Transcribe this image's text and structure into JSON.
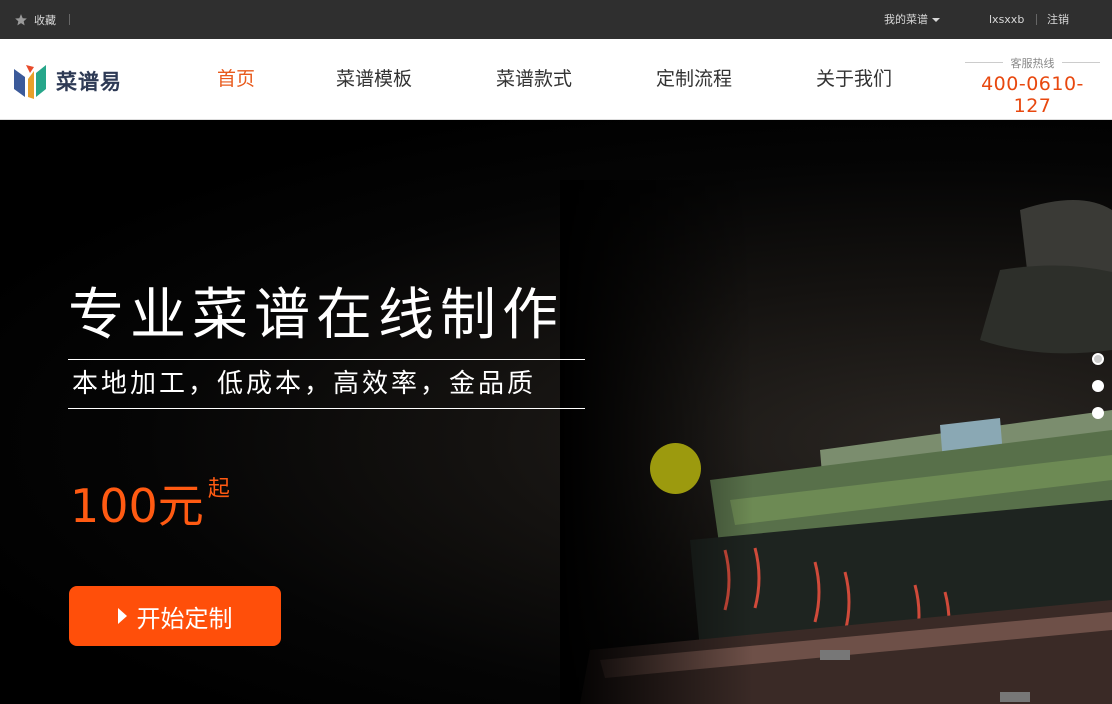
{
  "topbar": {
    "favorite_label": "收藏",
    "my_menu_label": "我的菜谱",
    "username": "lxsxxb",
    "logout_label": "注销"
  },
  "header": {
    "logo_text": "菜谱易",
    "nav": [
      {
        "label": "首页",
        "active": true
      },
      {
        "label": "菜谱模板",
        "active": false
      },
      {
        "label": "菜谱款式",
        "active": false
      },
      {
        "label": "定制流程",
        "active": false
      },
      {
        "label": "关于我们",
        "active": false
      }
    ],
    "hotline_label": "客服热线",
    "hotline_number": "400-0610-127"
  },
  "hero": {
    "title": "专业菜谱在线制作",
    "subtitle": "本地加工，低成本，高效率，金品质",
    "price": "100元",
    "price_suffix": "起",
    "cta_label": "开始定制",
    "slides": 3,
    "active_slide": 0
  },
  "colors": {
    "accent": "#ff4f0a",
    "nav_active": "#e85a1c",
    "topbar_bg": "#2f2f2f",
    "hotline": "#e8480f"
  },
  "icons": {
    "favorite": "star-icon",
    "dropdown": "caret-down-icon",
    "cta": "play-triangle-icon"
  }
}
